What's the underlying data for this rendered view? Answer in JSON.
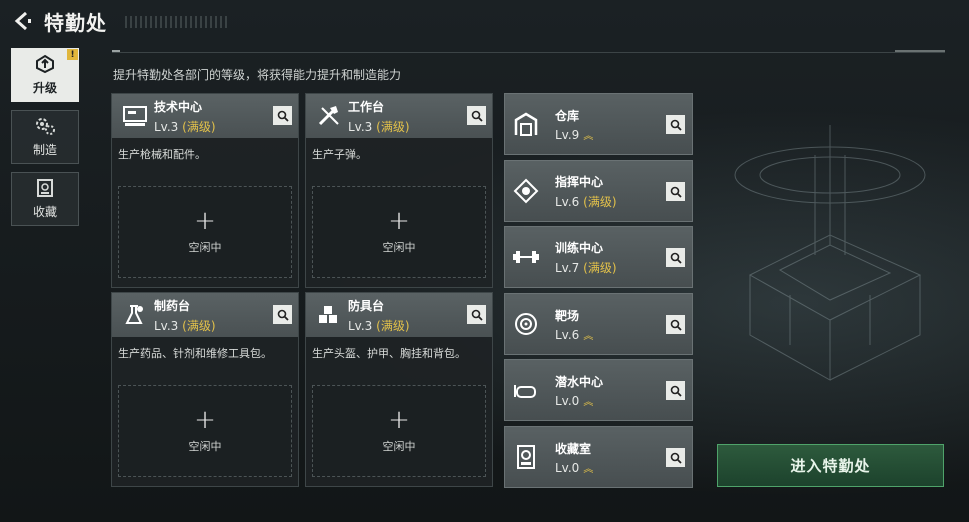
{
  "header": {
    "title": "特勤处"
  },
  "tabs": [
    {
      "label": "升级",
      "active": true,
      "badge": "!"
    },
    {
      "label": "制造",
      "active": false
    },
    {
      "label": "收藏",
      "active": false
    }
  ],
  "subtitle": "提升特勤处各部门的等级，将获得能力提升和制造能力",
  "departments": [
    {
      "name": "技术中心",
      "level": "Lv.3",
      "maxed": "(满级)",
      "desc": "生产枪械和配件。",
      "slot_status": "空闲中",
      "icon": "tech-center-icon"
    },
    {
      "name": "工作台",
      "level": "Lv.3",
      "maxed": "(满级)",
      "desc": "生产子弹。",
      "slot_status": "空闲中",
      "icon": "workbench-icon"
    },
    {
      "name": "制药台",
      "level": "Lv.3",
      "maxed": "(满级)",
      "desc": "生产药品、针剂和维修工具包。",
      "slot_status": "空闲中",
      "icon": "pharmacy-icon"
    },
    {
      "name": "防具台",
      "level": "Lv.3",
      "maxed": "(满级)",
      "desc": "生产头盔、护甲、胸挂和背包。",
      "slot_status": "空闲中",
      "icon": "armor-bench-icon"
    }
  ],
  "facilities": [
    {
      "name": "仓库",
      "level": "Lv.9",
      "maxed": "",
      "upgradable": true,
      "icon": "warehouse-icon"
    },
    {
      "name": "指挥中心",
      "level": "Lv.6",
      "maxed": "(满级)",
      "upgradable": false,
      "icon": "command-center-icon"
    },
    {
      "name": "训练中心",
      "level": "Lv.7",
      "maxed": "(满级)",
      "upgradable": false,
      "icon": "training-center-icon"
    },
    {
      "name": "靶场",
      "level": "Lv.6",
      "maxed": "",
      "upgradable": true,
      "icon": "shooting-range-icon"
    },
    {
      "name": "潜水中心",
      "level": "Lv.0",
      "maxed": "",
      "upgradable": true,
      "icon": "diving-center-icon"
    },
    {
      "name": "收藏室",
      "level": "Lv.0",
      "maxed": "",
      "upgradable": true,
      "icon": "collection-room-icon"
    }
  ],
  "enter_button": {
    "label": "进入特勤处"
  },
  "colors": {
    "accent_gold": "#e2c14a",
    "enter_green": "#4fa36a",
    "panel_header": "#5a6264"
  }
}
